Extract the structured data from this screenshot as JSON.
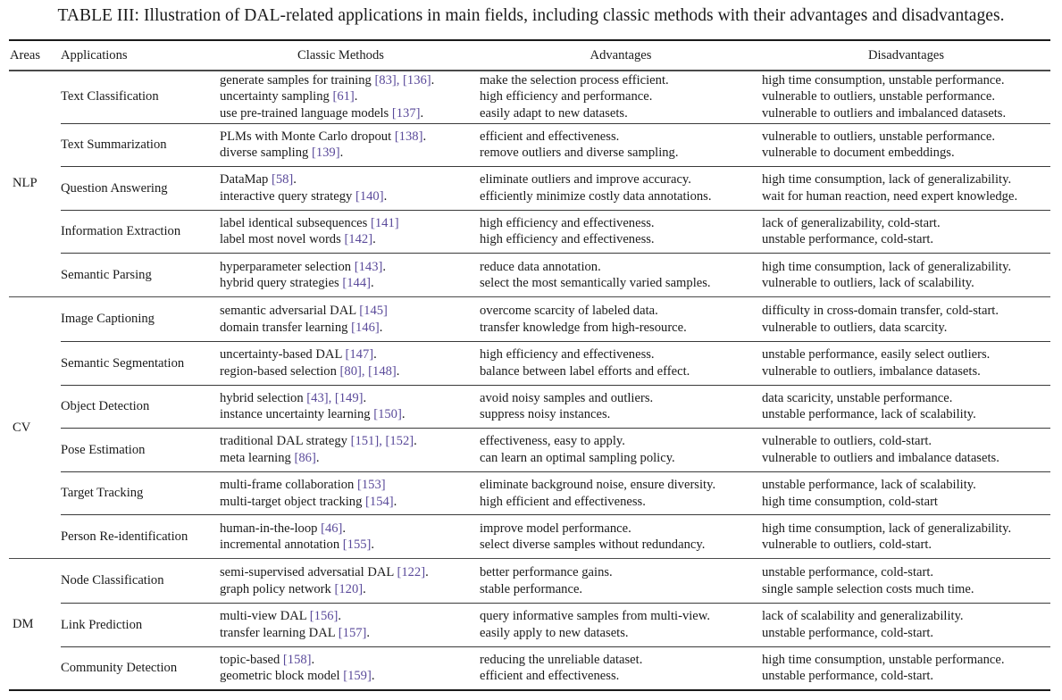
{
  "caption": "TABLE III: Illustration of DAL-related applications in main fields, including classic methods with their advantages and disadvantages.",
  "header": {
    "areas": "Areas",
    "applications": "Applications",
    "methods": "Classic Methods",
    "advantages": "Advantages",
    "disadvantages": "Disadvantages"
  },
  "accent_colors": {
    "reference_link": "#5a4a9a",
    "text": "#1a1a1a"
  },
  "groups": [
    {
      "area": "NLP",
      "rows": [
        {
          "application": "Text Classification",
          "methods": [
            {
              "text": "generate samples for training ",
              "refs": "[83], [136]",
              "tail": "."
            },
            {
              "text": "uncertainty sampling ",
              "refs": "[61]",
              "tail": "."
            },
            {
              "text": "use pre-trained language models ",
              "refs": "[137]",
              "tail": "."
            }
          ],
          "advantages": [
            "make the selection process efficient.",
            "high efficiency and performance.",
            "easily adapt to new datasets."
          ],
          "disadvantages": [
            "high time consumption, unstable performance.",
            "vulnerable to outliers, unstable performance.",
            "vulnerable to outliers and imbalanced datasets."
          ]
        },
        {
          "application": "Text Summarization",
          "methods": [
            {
              "text": "PLMs with Monte Carlo dropout ",
              "refs": "[138]",
              "tail": "."
            },
            {
              "text": "diverse sampling ",
              "refs": "[139]",
              "tail": "."
            }
          ],
          "advantages": [
            "efficient and effectiveness.",
            "remove outliers and diverse sampling."
          ],
          "disadvantages": [
            "vulnerable to outliers, unstable performance.",
            "vulnerable to document embeddings."
          ]
        },
        {
          "application": "Question Answering",
          "methods": [
            {
              "text": "DataMap ",
              "refs": "[58]",
              "tail": "."
            },
            {
              "text": "interactive query strategy ",
              "refs": "[140]",
              "tail": "."
            }
          ],
          "advantages": [
            "eliminate outliers and improve accuracy.",
            "efficiently minimize costly data annotations."
          ],
          "disadvantages": [
            "high time consumption, lack of generalizability.",
            "wait for human reaction, need expert knowledge."
          ]
        },
        {
          "application": "Information Extraction",
          "methods": [
            {
              "text": "label identical subsequences ",
              "refs": "[141]",
              "tail": ""
            },
            {
              "text": "label most novel words ",
              "refs": "[142]",
              "tail": "."
            }
          ],
          "advantages": [
            "high efficiency and effectiveness.",
            "high efficiency and effectiveness."
          ],
          "disadvantages": [
            "lack of generalizability, cold-start.",
            "unstable performance, cold-start."
          ]
        },
        {
          "application": "Semantic Parsing",
          "methods": [
            {
              "text": "hyperparameter selection ",
              "refs": "[143]",
              "tail": "."
            },
            {
              "text": "hybrid query strategies ",
              "refs": "[144]",
              "tail": "."
            }
          ],
          "advantages": [
            "reduce data annotation.",
            "select the most semantically varied samples."
          ],
          "disadvantages": [
            "high time consumption, lack of generalizability.",
            "vulnerable to outliers, lack of scalability."
          ]
        }
      ]
    },
    {
      "area": "CV",
      "rows": [
        {
          "application": "Image Captioning",
          "methods": [
            {
              "text": "semantic adversarial DAL ",
              "refs": "[145]",
              "tail": ""
            },
            {
              "text": "domain transfer learning ",
              "refs": "[146]",
              "tail": "."
            }
          ],
          "advantages": [
            "overcome scarcity of labeled data.",
            "transfer knowledge from high-resource."
          ],
          "disadvantages": [
            "difficulty in cross-domain transfer, cold-start.",
            "vulnerable to outliers, data scarcity."
          ]
        },
        {
          "application": "Semantic Segmentation",
          "methods": [
            {
              "text": "uncertainty-based DAL ",
              "refs": "[147]",
              "tail": "."
            },
            {
              "text": "region-based selection ",
              "refs": "[80], [148]",
              "tail": "."
            }
          ],
          "advantages": [
            "high efficiency and effectiveness.",
            "balance between label efforts and effect."
          ],
          "disadvantages": [
            "unstable performance, easily select outliers.",
            "vulnerable to outliers, imbalance datasets."
          ]
        },
        {
          "application": "Object Detection",
          "methods": [
            {
              "text": "hybrid selection ",
              "refs": "[43], [149]",
              "tail": "."
            },
            {
              "text": "instance uncertainty learning ",
              "refs": "[150]",
              "tail": "."
            }
          ],
          "advantages": [
            "avoid noisy samples and outliers.",
            "suppress noisy instances."
          ],
          "disadvantages": [
            "data scaricity, unstable performance.",
            "unstable performance, lack of scalability."
          ]
        },
        {
          "application": "Pose Estimation",
          "methods": [
            {
              "text": "traditional DAL strategy ",
              "refs": "[151], [152]",
              "tail": "."
            },
            {
              "text": "meta learning ",
              "refs": "[86]",
              "tail": "."
            }
          ],
          "advantages": [
            "effectiveness, easy to apply.",
            "can learn an optimal sampling policy."
          ],
          "disadvantages": [
            "vulnerable to outliers, cold-start.",
            "vulnerable to outliers and imbalance datasets."
          ]
        },
        {
          "application": "Target Tracking",
          "methods": [
            {
              "text": "multi-frame collaboration ",
              "refs": "[153]",
              "tail": ""
            },
            {
              "text": "multi-target object tracking ",
              "refs": "[154]",
              "tail": "."
            }
          ],
          "advantages": [
            "eliminate background noise, ensure diversity.",
            "high efficient and effectiveness."
          ],
          "disadvantages": [
            "unstable performance, lack of scalability.",
            "high time consumption, cold-start"
          ]
        },
        {
          "application": "Person Re-identification",
          "methods": [
            {
              "text": "human-in-the-loop ",
              "refs": "[46]",
              "tail": "."
            },
            {
              "text": "incremental annotation ",
              "refs": "[155]",
              "tail": "."
            }
          ],
          "advantages": [
            "improve model performance.",
            "select diverse samples without redundancy."
          ],
          "disadvantages": [
            "high time consumption, lack of generalizability.",
            "vulnerable to outliers, cold-start."
          ]
        }
      ]
    },
    {
      "area": "DM",
      "rows": [
        {
          "application": "Node Classification",
          "methods": [
            {
              "text": "semi-supervised adversatial DAL ",
              "refs": "[122]",
              "tail": "."
            },
            {
              "text": "graph policy network ",
              "refs": "[120]",
              "tail": "."
            }
          ],
          "advantages": [
            "better performance gains.",
            "stable performance."
          ],
          "disadvantages": [
            "unstable performance, cold-start.",
            "single sample selection costs much time."
          ]
        },
        {
          "application": "Link Prediction",
          "methods": [
            {
              "text": "multi-view DAL ",
              "refs": "[156]",
              "tail": "."
            },
            {
              "text": "transfer learning DAL ",
              "refs": "[157]",
              "tail": "."
            }
          ],
          "advantages": [
            "query informative samples from multi-view.",
            "easily apply to new datasets."
          ],
          "disadvantages": [
            "lack of scalability and generalizability.",
            "unstable performance, cold-start."
          ]
        },
        {
          "application": "Community Detection",
          "methods": [
            {
              "text": "topic-based ",
              "refs": "[158]",
              "tail": "."
            },
            {
              "text": "geometric block model ",
              "refs": "[159]",
              "tail": "."
            }
          ],
          "advantages": [
            "reducing the unreliable dataset.",
            "efficient and effectiveness."
          ],
          "disadvantages": [
            "high time consumption, unstable performance.",
            "unstable performance, cold-start."
          ]
        }
      ]
    }
  ]
}
